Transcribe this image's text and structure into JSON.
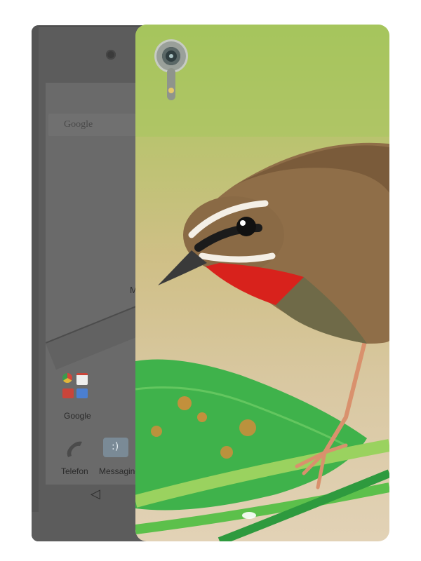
{
  "phone_screen": {
    "search_label": "Google",
    "clock_letter": "M",
    "apps": [
      {
        "label": "Google",
        "icon": "google-apps-folder-icon"
      },
      {
        "label": "Telefon",
        "icon": "phone-icon"
      },
      {
        "label": "Messaging",
        "icon": "messaging-icon"
      }
    ],
    "nav_back_glyph": "◁"
  },
  "colors": {
    "phone_body": "#5c5c5c",
    "case_background_top": "#a3c35a",
    "case_background_bottom": "#e2d2b6",
    "bird_throat": "#d8221c",
    "bird_body": "#8f6e48",
    "leaf": "#3bb54a"
  },
  "case_print": {
    "subject": "bird-on-leaf-icon"
  }
}
